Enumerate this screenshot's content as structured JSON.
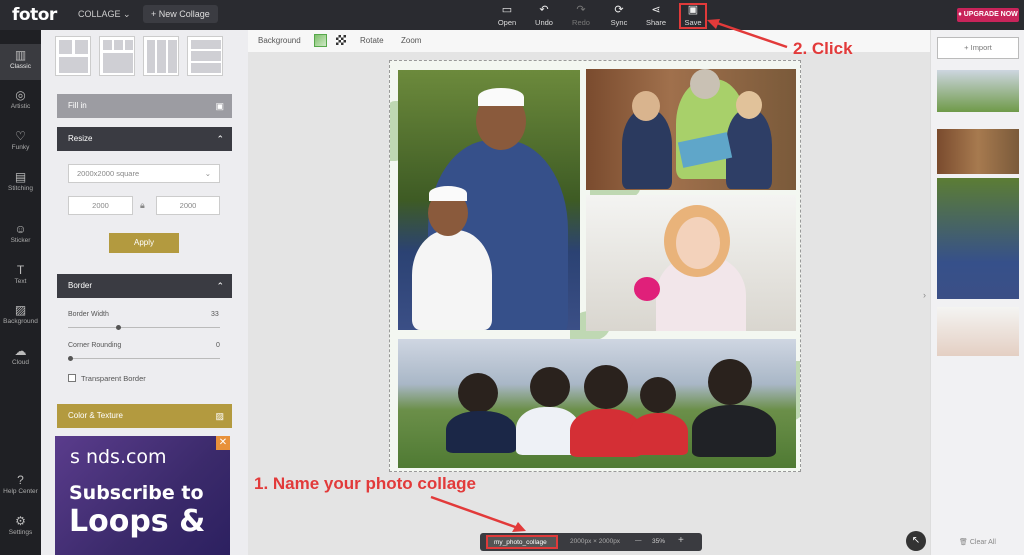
{
  "app": {
    "logo": "fotor",
    "mode": "COLLAGE",
    "new_collage": "+  New Collage",
    "upgrade": "UPGRADE NOW"
  },
  "toolbar": [
    {
      "name": "open",
      "label": "Open",
      "icon": "folder-icon",
      "glyph": "▭"
    },
    {
      "name": "undo",
      "label": "Undo",
      "icon": "undo-icon",
      "glyph": "↶"
    },
    {
      "name": "redo",
      "label": "Redo",
      "icon": "redo-icon",
      "glyph": "↷",
      "disabled": true
    },
    {
      "name": "sync",
      "label": "Sync",
      "icon": "sync-icon",
      "glyph": "⟳"
    },
    {
      "name": "share",
      "label": "Share",
      "icon": "share-icon",
      "glyph": "⋖"
    },
    {
      "name": "save",
      "label": "Save",
      "icon": "save-icon",
      "glyph": "▣"
    }
  ],
  "nav": [
    {
      "label": "Classic",
      "icon": "classic-icon",
      "glyph": "▥",
      "active": true
    },
    {
      "label": "Artistic",
      "icon": "artistic-icon",
      "glyph": "◎"
    },
    {
      "label": "Funky",
      "icon": "funky-icon",
      "glyph": "♡"
    },
    {
      "label": "Stitching",
      "icon": "stitching-icon",
      "glyph": "▤"
    },
    {
      "label": "Sticker",
      "icon": "sticker-icon",
      "glyph": "☺"
    },
    {
      "label": "Text",
      "icon": "text-icon",
      "glyph": "T"
    },
    {
      "label": "Background",
      "icon": "background-icon",
      "glyph": "▨"
    },
    {
      "label": "Cloud",
      "icon": "cloud-icon",
      "glyph": "☁"
    },
    {
      "label": "Help Center",
      "icon": "help-icon",
      "glyph": "?"
    },
    {
      "label": "Settings",
      "icon": "settings-icon",
      "glyph": "⚙"
    }
  ],
  "panel": {
    "fill_in": "Fill in",
    "resize": "Resize",
    "size_option": "2000x2000 square",
    "width": "2000",
    "height": "2000",
    "apply": "Apply",
    "border": "Border",
    "border_width_label": "Border Width",
    "border_width_value": "33",
    "corner_rounding_label": "Corner Rounding",
    "corner_rounding_value": "0",
    "transparent_border": "Transparent Border",
    "color_texture": "Color & Texture"
  },
  "ad": {
    "brand": "s  nds.com",
    "line1": "Subscribe to",
    "line2": "Loops &"
  },
  "canvas_toolbar": {
    "background": "Background",
    "rotate": "Rotate",
    "zoom": "Zoom"
  },
  "right": {
    "import": "+   Import",
    "clear": "Clear All"
  },
  "status": {
    "filename": "my_photo_collage",
    "dims": "2000px × 2000px",
    "minus": "—",
    "zoom": "35%",
    "plus": "+"
  },
  "annotations": {
    "step1": "1. Name your photo collage",
    "step2": "2. Click"
  },
  "colors": {
    "accent": "#b39a3f",
    "annotation": "#e23a3a",
    "upgrade": "#c8245a"
  }
}
